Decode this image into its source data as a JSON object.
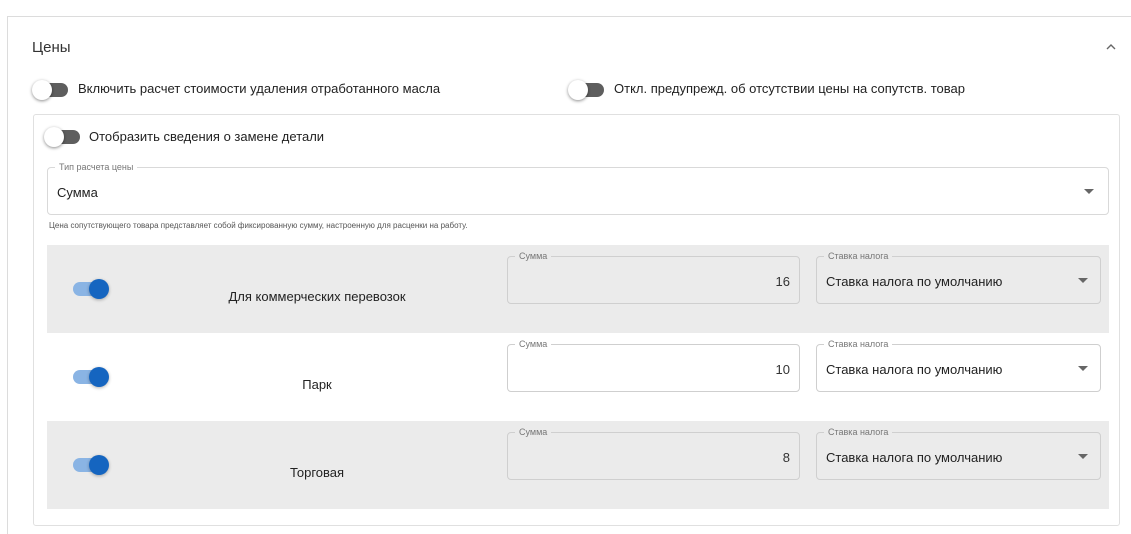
{
  "section": {
    "title": "Цены",
    "collapse_icon": "chevron-up-icon"
  },
  "toggles": {
    "waste_oil": {
      "label": "Включить расчет стоимости удаления отработанного масла",
      "on": false
    },
    "missing_price_warning": {
      "label": "Откл. предупрежд. об отсутствии цены на сопутств. товар",
      "on": false
    },
    "part_replacement": {
      "label": "Отобразить сведения о замене детали",
      "on": false
    }
  },
  "price_type": {
    "label": "Тип расчета цены",
    "value": "Сумма",
    "hint": "Цена сопутствующего товара представляет собой фиксированную сумму, настроенную для расценки на работу."
  },
  "rows": [
    {
      "label": "Для коммерческих перевозок",
      "enabled": true,
      "amount_label": "Сумма",
      "amount": "16",
      "tax_label": "Ставка налога",
      "tax": "Ставка налога по умолчанию"
    },
    {
      "label": "Парк",
      "enabled": true,
      "amount_label": "Сумма",
      "amount": "10",
      "tax_label": "Ставка налога",
      "tax": "Ставка налога по умолчанию"
    },
    {
      "label": "Торговая",
      "enabled": true,
      "amount_label": "Сумма",
      "amount": "8",
      "tax_label": "Ставка налога",
      "tax": "Ставка налога по умолчанию"
    }
  ],
  "colors": {
    "switch_on": "#1565c0",
    "switch_on_track": "#8ab4e4",
    "switch_off_track": "#5e5e5e",
    "row_grey": "#ebebeb"
  }
}
